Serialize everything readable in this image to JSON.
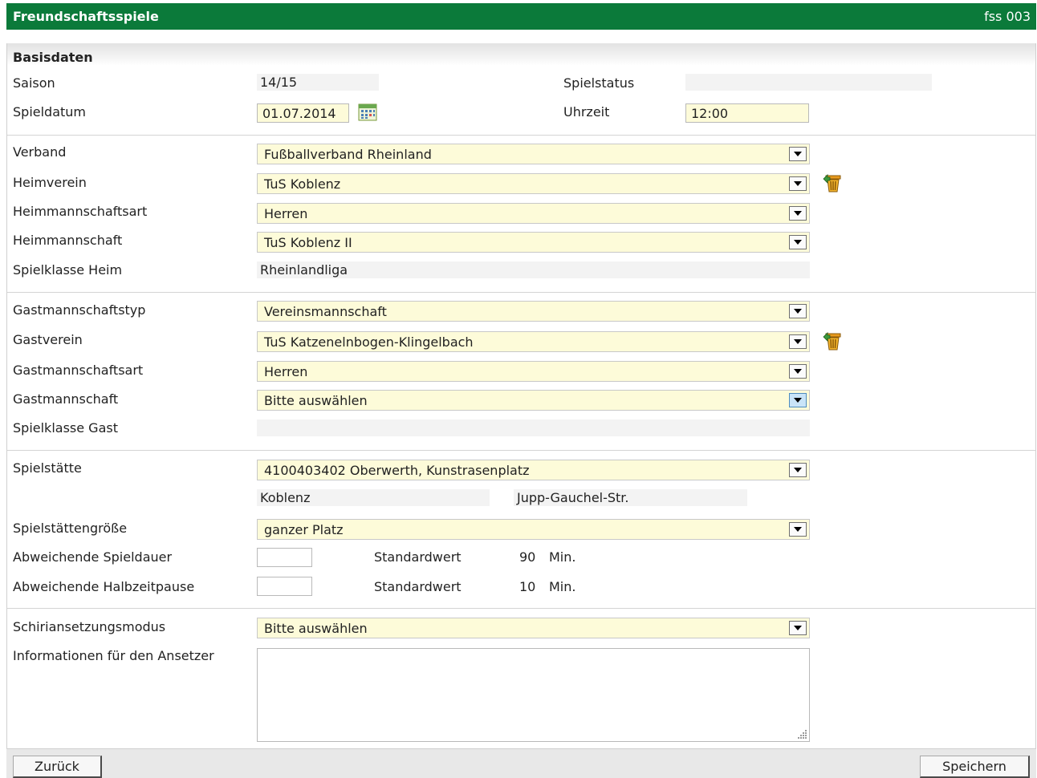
{
  "header": {
    "title": "Freundschaftsspiele",
    "code": "fss 003"
  },
  "section": {
    "title": "Basisdaten"
  },
  "base": {
    "saison_label": "Saison",
    "saison_value": "14/15",
    "status_label": "Spielstatus",
    "status_value": "",
    "datum_label": "Spieldatum",
    "datum_value": "01.07.2014",
    "uhrzeit_label": "Uhrzeit",
    "uhrzeit_value": "12:00"
  },
  "heim": {
    "verband_label": "Verband",
    "verband_value": "Fußballverband Rheinland",
    "verein_label": "Heimverein",
    "verein_value": "TuS Koblenz",
    "art_label": "Heimmannschaftsart",
    "art_value": "Herren",
    "mannschaft_label": "Heimmannschaft",
    "mannschaft_value": "TuS Koblenz II",
    "klasse_label": "Spielklasse Heim",
    "klasse_value": "Rheinlandliga"
  },
  "gast": {
    "typ_label": "Gastmannschaftstyp",
    "typ_value": "Vereinsmannschaft",
    "verein_label": "Gastverein",
    "verein_value": "TuS Katzenelnbogen-Klingelbach",
    "art_label": "Gastmannschaftsart",
    "art_value": "Herren",
    "mannschaft_label": "Gastmannschaft",
    "mannschaft_value": "Bitte auswählen",
    "klasse_label": "Spielklasse Gast",
    "klasse_value": ""
  },
  "platz": {
    "staette_label": "Spielstätte",
    "staette_value": "4100403402 Oberwerth, Kunstrasenplatz",
    "ort": "Koblenz",
    "strasse": "Jupp-Gauchel-Str.",
    "groesse_label": "Spielstättengröße",
    "groesse_value": "ganzer Platz",
    "dauer_label": "Abweichende Spieldauer",
    "dauer_value": "",
    "dauer_std_label": "Standardwert",
    "dauer_std_value": "90",
    "dauer_unit": "Min.",
    "pause_label": "Abweichende Halbzeitpause",
    "pause_value": "",
    "pause_std_label": "Standardwert",
    "pause_std_value": "10",
    "pause_unit": "Min."
  },
  "schiri": {
    "modus_label": "Schiriansetzungsmodus",
    "modus_value": "Bitte auswählen",
    "info_label": "Informationen für den Ansetzer",
    "info_value": ""
  },
  "buttons": {
    "back": "Zurück",
    "save": "Speichern"
  },
  "colors": {
    "header_bg": "#0b7a3a",
    "input_bg": "#fdfbd9",
    "readonly_bg": "#f3f3f3"
  }
}
